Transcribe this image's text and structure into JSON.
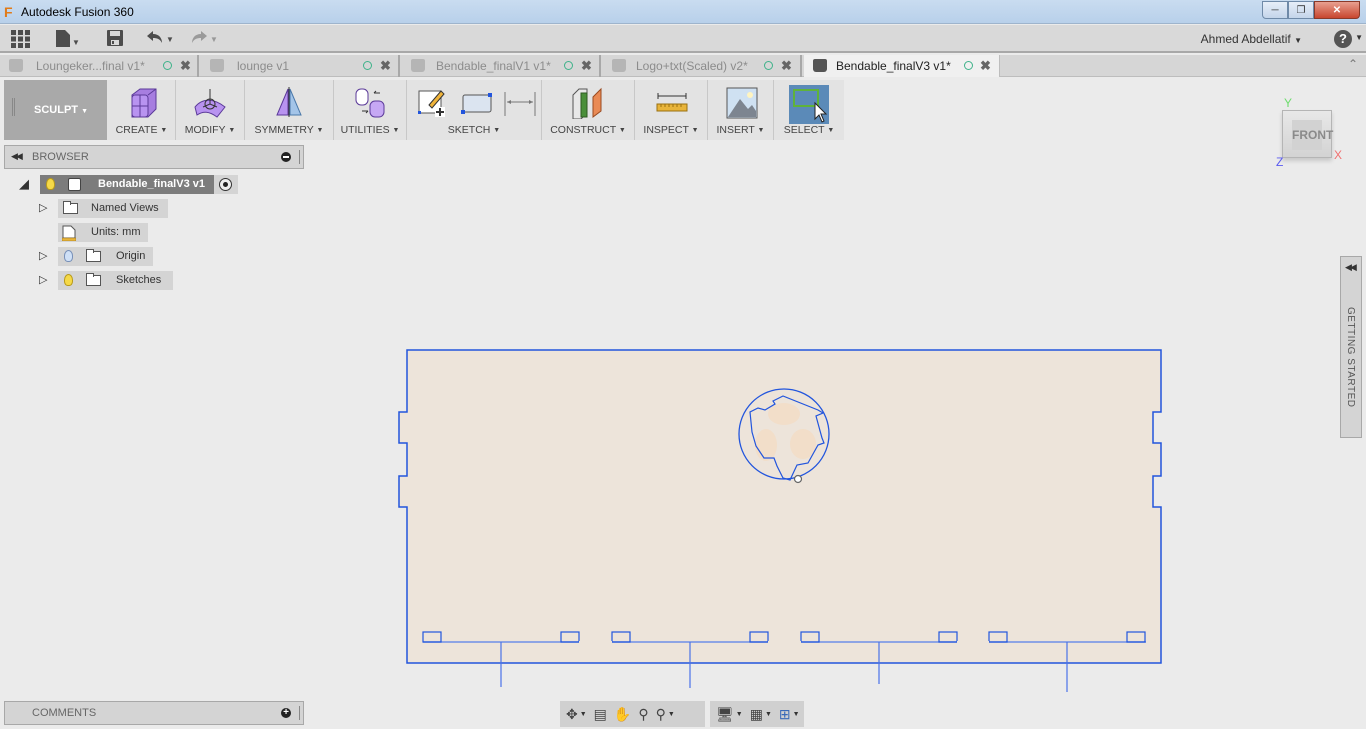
{
  "window": {
    "title": "Autodesk Fusion 360",
    "controls": [
      "minimize",
      "restore",
      "close"
    ]
  },
  "quick_access": {
    "items": [
      {
        "name": "data-panel",
        "icon": "grid-icon"
      },
      {
        "name": "file",
        "icon": "file-icon"
      },
      {
        "name": "save",
        "icon": "save-icon"
      },
      {
        "name": "undo",
        "icon": "undo-icon"
      },
      {
        "name": "redo",
        "icon": "redo-icon"
      }
    ],
    "user": "Ahmed Abdellatif",
    "help": "?"
  },
  "tabs": [
    {
      "label": "Loungeker...final v1*",
      "active": false
    },
    {
      "label": "lounge v1",
      "active": false
    },
    {
      "label": "Bendable_finalV1 v1*",
      "active": false
    },
    {
      "label": "Logo+txt(Scaled) v2*",
      "active": false
    },
    {
      "label": "Bendable_finalV3 v1*",
      "active": true
    }
  ],
  "toolbar": {
    "workspace": "SCULPT",
    "groups": [
      {
        "label": "CREATE"
      },
      {
        "label": "MODIFY"
      },
      {
        "label": "SYMMETRY"
      },
      {
        "label": "UTILITIES"
      },
      {
        "label": "SKETCH"
      },
      {
        "label": "CONSTRUCT"
      },
      {
        "label": "INSPECT"
      },
      {
        "label": "INSERT"
      },
      {
        "label": "SELECT",
        "active": true
      }
    ]
  },
  "browser": {
    "title": "BROWSER",
    "root": "Bendable_finalV3 v1",
    "nodes": [
      {
        "label": "Named Views",
        "expandable": true
      },
      {
        "label": "Units: mm",
        "expandable": false
      },
      {
        "label": "Origin",
        "expandable": true,
        "visible": false
      },
      {
        "label": "Sketches",
        "expandable": true,
        "visible": true
      }
    ]
  },
  "viewcube": {
    "face": "FRONT",
    "axes": {
      "x": "X",
      "y": "Y",
      "z": "Z"
    }
  },
  "side_panel": {
    "label": "GETTING STARTED"
  },
  "comments": {
    "title": "COMMENTS"
  },
  "colors": {
    "sketch_line": "#2255dd",
    "profile_fill": "#ede4da",
    "select_active": "#5b8ab8"
  }
}
